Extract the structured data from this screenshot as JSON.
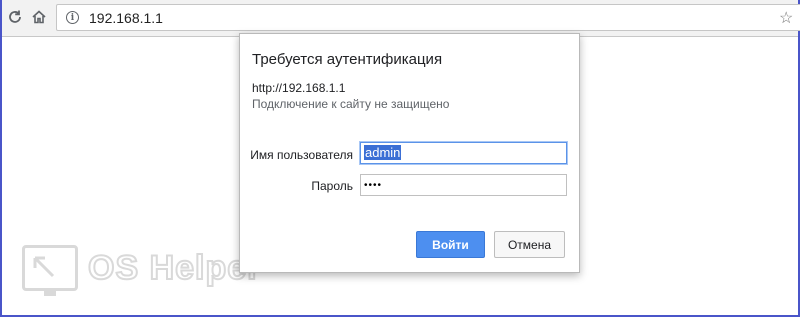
{
  "browser": {
    "url": "192.168.1.1",
    "icons": [
      "reload-icon",
      "home-icon",
      "info-icon",
      "star-icon"
    ]
  },
  "dialog": {
    "title": "Требуется аутентификация",
    "origin": "http://192.168.1.1",
    "warning": "Подключение к сайту не защищено",
    "username_label": "Имя пользователя",
    "username_value": "admin",
    "password_label": "Пароль",
    "password_mask": "••••",
    "login_button": "Войти",
    "cancel_button": "Отмена",
    "colors": {
      "primary": "#4d8ff0",
      "selection": "#3b6fd5"
    }
  },
  "watermark": {
    "text": "OS Helper"
  }
}
